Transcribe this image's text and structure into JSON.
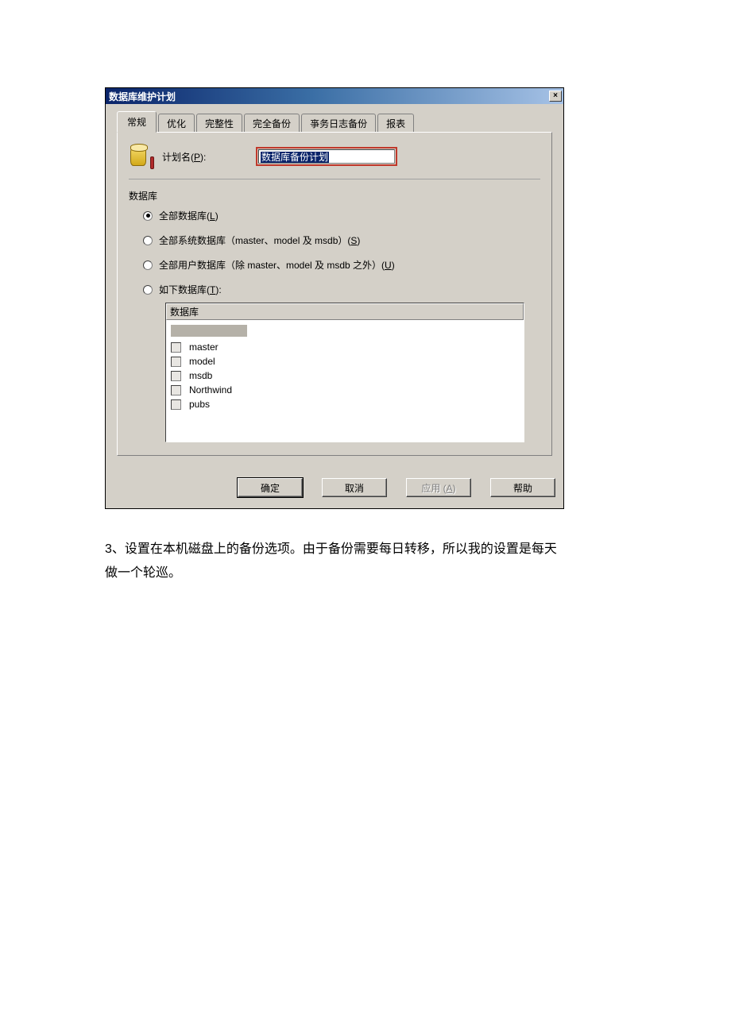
{
  "dialog": {
    "title": "数据库维护计划",
    "close_icon": "×"
  },
  "tabs": {
    "items": [
      {
        "label": "常规"
      },
      {
        "label": "优化"
      },
      {
        "label": "完整性"
      },
      {
        "label": "完全备份"
      },
      {
        "label": "亊务日志备份"
      },
      {
        "label": "报表"
      }
    ]
  },
  "plan": {
    "label_prefix": "计划名(",
    "label_underline": "P",
    "label_suffix": "):",
    "value": "数据库备份计划"
  },
  "section": {
    "label": "数据库"
  },
  "radios": [
    {
      "prefix": "全部数据库(",
      "u": "L",
      "suffix": ")"
    },
    {
      "prefix": "全部系统数据库（master、model 及 msdb）(",
      "u": "S",
      "suffix": ")"
    },
    {
      "prefix": "全部用户数据库（除 master、model 及 msdb 之外）(",
      "u": "U",
      "suffix": ")"
    },
    {
      "prefix": "如下数据库(",
      "u": "T",
      "suffix": "):"
    }
  ],
  "dblist": {
    "header": "数据库",
    "items": [
      "master",
      "model",
      "msdb",
      "Northwind",
      "pubs"
    ]
  },
  "buttons": {
    "ok": "确定",
    "cancel": "取消",
    "apply_prefix": "应用 (",
    "apply_u": "A",
    "apply_suffix": ")",
    "help": "帮助"
  },
  "caption": "3、设置在本机磁盘上的备份选项。由于备份需要每日转移，所以我的设置是每天做一个轮巡。"
}
